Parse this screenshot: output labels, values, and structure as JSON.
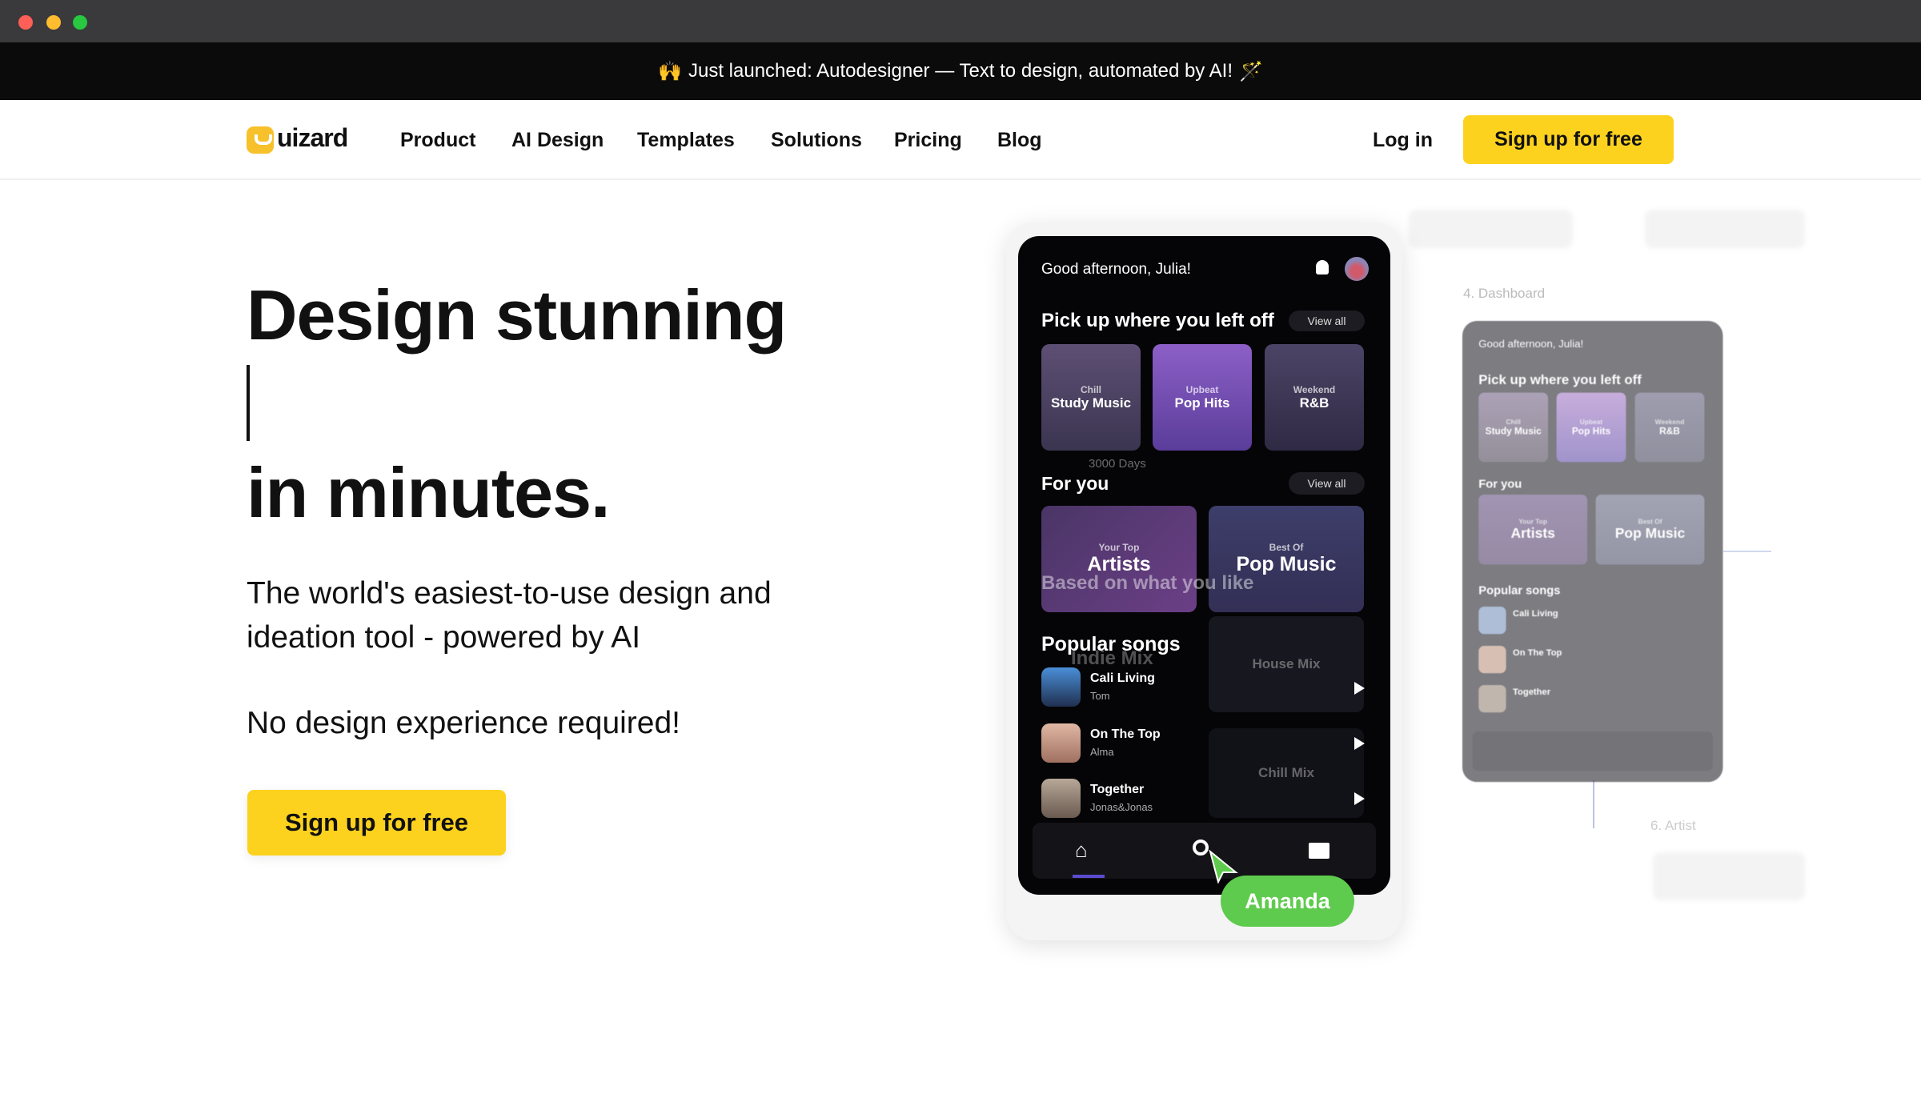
{
  "window": {
    "traffic_lights": [
      "#fe5f57",
      "#febc2e",
      "#28c840"
    ]
  },
  "banner": {
    "emoji": "🙌",
    "text": "Just launched: Autodesigner — Text to design, automated by AI!",
    "wand": "🪄"
  },
  "nav": {
    "logo": "uizard",
    "items": [
      "Product",
      "AI Design",
      "Templates",
      "Solutions",
      "Pricing",
      "Blog"
    ],
    "login": "Log in",
    "signup": "Sign up for free"
  },
  "hero": {
    "title_line1": "Design stunning",
    "title_line2": "in minutes.",
    "subtitle_line1": "The world's easiest-to-use design and",
    "subtitle_line2": "ideation tool - powered by AI",
    "note": "No design experience required!",
    "cta": "Sign up for free"
  },
  "phone": {
    "greeting": "Good afternoon, Julia!",
    "section1": "Pick up where you left off",
    "view_all": "View all",
    "cards": [
      {
        "small": "Chill",
        "title": "Study Music"
      },
      {
        "small": "Upbeat",
        "title": "Pop Hits"
      },
      {
        "small": "Weekend",
        "title": "R&B"
      }
    ],
    "section2": "For you",
    "for_you": [
      {
        "small": "Your Top",
        "title": "Artists"
      },
      {
        "small": "Best Of",
        "title": "Pop Music"
      }
    ],
    "ghost_text": {
      "based": "Based on what you like",
      "days": "3000 Days",
      "house": "House Mix",
      "chill": "Chill Mix",
      "indie": "Indie Mix"
    },
    "section3": "Popular songs",
    "songs": [
      {
        "title": "Cali Living",
        "artist": "Tom"
      },
      {
        "title": "On The Top",
        "artist": "Alma"
      },
      {
        "title": "Together",
        "artist": "Jonas&Jonas"
      }
    ],
    "cursor_user": "Amanda"
  },
  "flow": {
    "label_dashboard": "4. Dashboard",
    "label_artist": "6. Artist"
  },
  "colors": {
    "accent": "#fdd21f",
    "cursor": "#5fcb4e"
  }
}
